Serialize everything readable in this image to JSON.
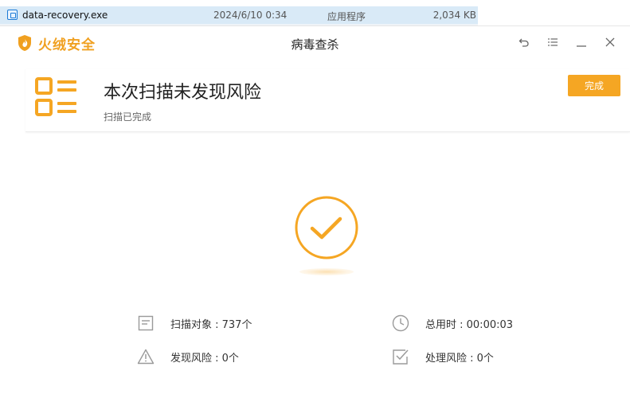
{
  "explorer": {
    "file_name": "data-recovery.exe",
    "date": "2024/6/10 0:34",
    "type": "应用程序",
    "size": "2,034 KB"
  },
  "window": {
    "brand": "火绒安全",
    "title": "病毒查杀",
    "accent": "#f5a623"
  },
  "summary": {
    "title": "本次扫描未发现风险",
    "subtitle": "扫描已完成",
    "done_label": "完成"
  },
  "stats": {
    "scanned": "扫描对象 : 737个",
    "duration": "总用时 : 00:00:03",
    "risks_found": "发现风险 : 0个",
    "risks_handled": "处理风险 : 0个"
  },
  "icons": {
    "back": "back-icon",
    "menu": "menu-icon",
    "minimize": "minimize-icon",
    "close": "close-icon"
  }
}
